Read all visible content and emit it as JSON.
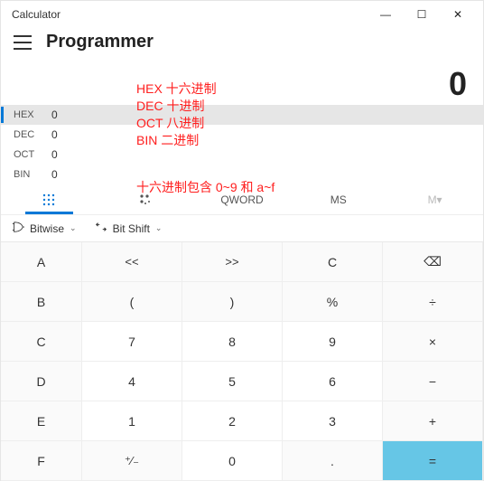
{
  "window": {
    "title": "Calculator",
    "min": "—",
    "max": "☐",
    "close": "✕"
  },
  "header": {
    "mode": "Programmer"
  },
  "display": {
    "value": "0"
  },
  "bases": [
    {
      "label": "HEX",
      "value": "0",
      "active": true
    },
    {
      "label": "DEC",
      "value": "0",
      "active": false
    },
    {
      "label": "OCT",
      "value": "0",
      "active": false
    },
    {
      "label": "BIN",
      "value": "0",
      "active": false
    }
  ],
  "tabs": {
    "fullkeypad_icon": "full-keypad-icon",
    "bitkeypad_icon": "bit-keypad-icon",
    "qword": "QWORD",
    "ms": "MS",
    "mr": "M▾"
  },
  "drops": {
    "bitwise_icon": "gate-icon",
    "bitwise": "Bitwise",
    "bitshift_icon": "shift-icon",
    "bitshift": "Bit Shift"
  },
  "keys": {
    "r0": {
      "a": "A",
      "lsh": "<<",
      "rsh": ">>",
      "c": "C",
      "back": "⌫"
    },
    "r1": {
      "b": "B",
      "lp": "(",
      "rp": ")",
      "pct": "%",
      "div": "÷"
    },
    "r2": {
      "c": "C",
      "k7": "7",
      "k8": "8",
      "k9": "9",
      "mul": "×"
    },
    "r3": {
      "d": "D",
      "k4": "4",
      "k5": "5",
      "k6": "6",
      "sub": "−"
    },
    "r4": {
      "e": "E",
      "k1": "1",
      "k2": "2",
      "k3": "3",
      "add": "+"
    },
    "r5": {
      "f": "F",
      "pm": "⁺⁄₋",
      "k0": "0",
      "dot": ".",
      "eq": "="
    }
  },
  "annot": {
    "lines": [
      "HEX 十六进制",
      "DEC 十进制",
      "OCT 八进制",
      "BIN 二进制"
    ],
    "note": "十六进制包含 0~9 和 a~f"
  }
}
